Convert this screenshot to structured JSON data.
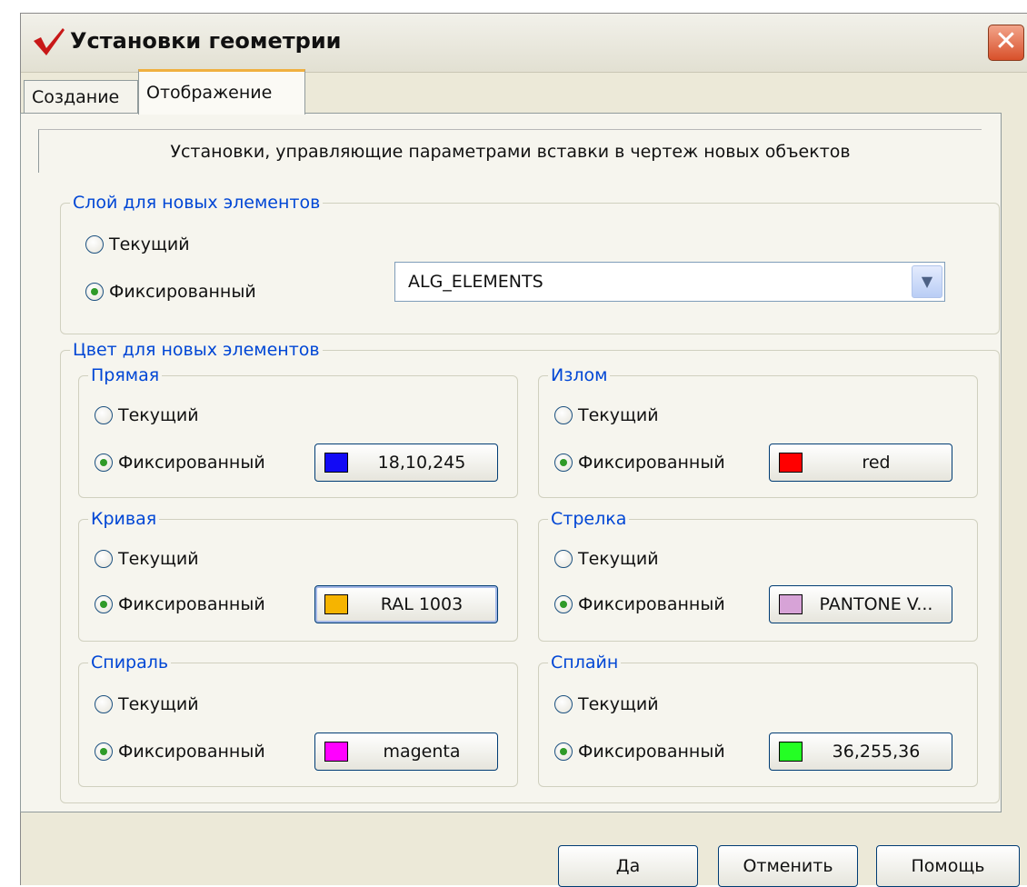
{
  "window": {
    "title": "Установки геометрии",
    "close_symbol": "✕",
    "accent_color": "#c81818"
  },
  "tabs": [
    {
      "label": "Создание",
      "active": false
    },
    {
      "label": "Отображение",
      "active": true
    }
  ],
  "panel": {
    "description": "Установки, управляющие параметрами вставки в чертеж новых объектов"
  },
  "layer": {
    "legend": "Слой для новых элементов",
    "current_label": "Текущий",
    "fixed_label": "Фиксированный",
    "selected": "fixed",
    "value": "ALG_ELEMENTS"
  },
  "color": {
    "legend": "Цвет для новых элементов",
    "groups": [
      {
        "name": "Прямая",
        "current_label": "Текущий",
        "fixed_label": "Фиксированный",
        "selected": "fixed",
        "value": "18,10,245",
        "swatch": "#120af5"
      },
      {
        "name": "Излом",
        "current_label": "Текущий",
        "fixed_label": "Фиксированный",
        "selected": "fixed",
        "value": "red",
        "swatch": "#ff0000"
      },
      {
        "name": "Кривая",
        "current_label": "Текущий",
        "fixed_label": "Фиксированный",
        "selected": "fixed",
        "value": "RAL 1003",
        "swatch": "#f6b400"
      },
      {
        "name": "Стрелка",
        "current_label": "Текущий",
        "fixed_label": "Фиксированный",
        "selected": "fixed",
        "value": "PANTONE V...",
        "swatch": "#d7a3d7"
      },
      {
        "name": "Спираль",
        "current_label": "Текущий",
        "fixed_label": "Фиксированный",
        "selected": "fixed",
        "value": "magenta",
        "swatch": "#ff00ff"
      },
      {
        "name": "Сплайн",
        "current_label": "Текущий",
        "fixed_label": "Фиксированный",
        "selected": "fixed",
        "value": "36,255,36",
        "swatch": "#24ff24"
      }
    ]
  },
  "buttons": {
    "ok": "Да",
    "cancel": "Отменить",
    "help": "Помощь"
  }
}
